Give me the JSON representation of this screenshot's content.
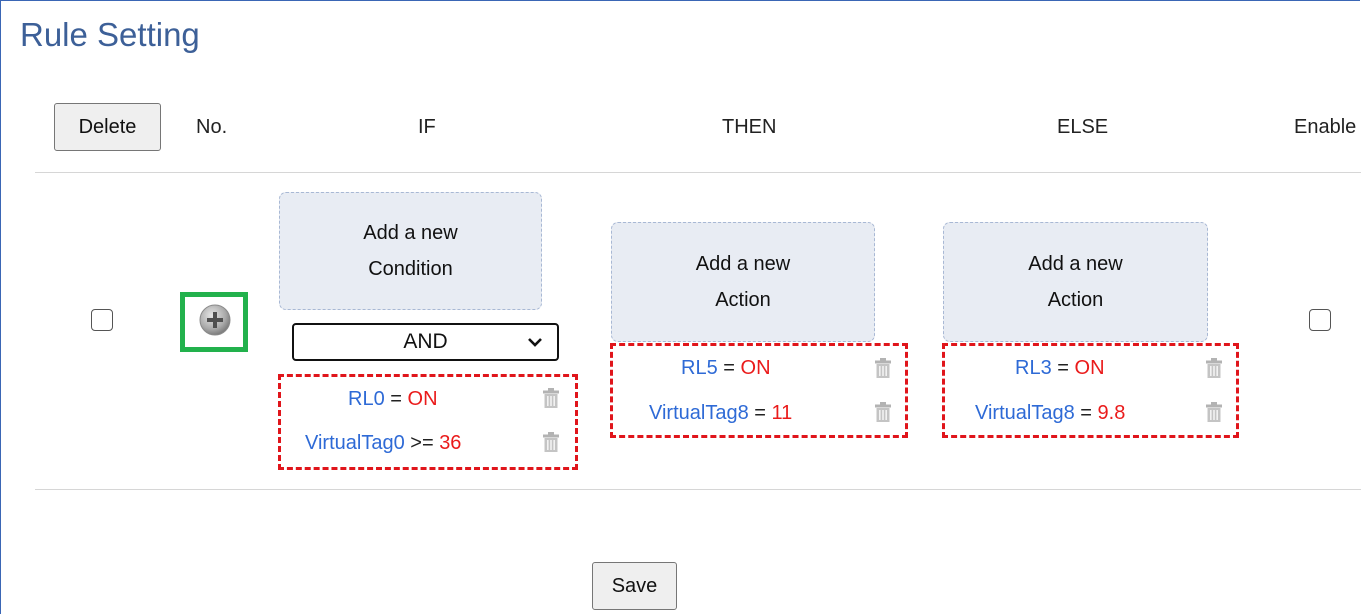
{
  "title": "Rule Setting",
  "header": {
    "delete_label": "Delete",
    "no_label": "No.",
    "if_label": "IF",
    "then_label": "THEN",
    "else_label": "ELSE",
    "enable_label": "Enable"
  },
  "rule": {
    "if_add": [
      "Add a new",
      "Condition"
    ],
    "logic_selected": "AND",
    "conditions": [
      {
        "tag": "RL0",
        "op": "=",
        "value": "ON"
      },
      {
        "tag": "VirtualTag0",
        "op": ">=",
        "value": "36"
      }
    ],
    "then_add": [
      "Add a new",
      "Action"
    ],
    "then_actions": [
      {
        "tag": "RL5",
        "op": "=",
        "value": "ON"
      },
      {
        "tag": "VirtualTag8",
        "op": "=",
        "value": "11"
      }
    ],
    "else_add": [
      "Add a new",
      "Action"
    ],
    "else_actions": [
      {
        "tag": "RL3",
        "op": "=",
        "value": "ON"
      },
      {
        "tag": "VirtualTag8",
        "op": "=",
        "value": "9.8"
      }
    ]
  },
  "save_label": "Save",
  "colors": {
    "title": "#3d6098",
    "tag": "#2e6ad6",
    "value": "#ea1b1b",
    "highlight_dashed": "#e0151b",
    "highlight_plus": "#22b14c"
  },
  "icons": {
    "add": "plus-circle-icon",
    "delete_item": "trash-icon",
    "dropdown": "chevron-down-icon"
  }
}
